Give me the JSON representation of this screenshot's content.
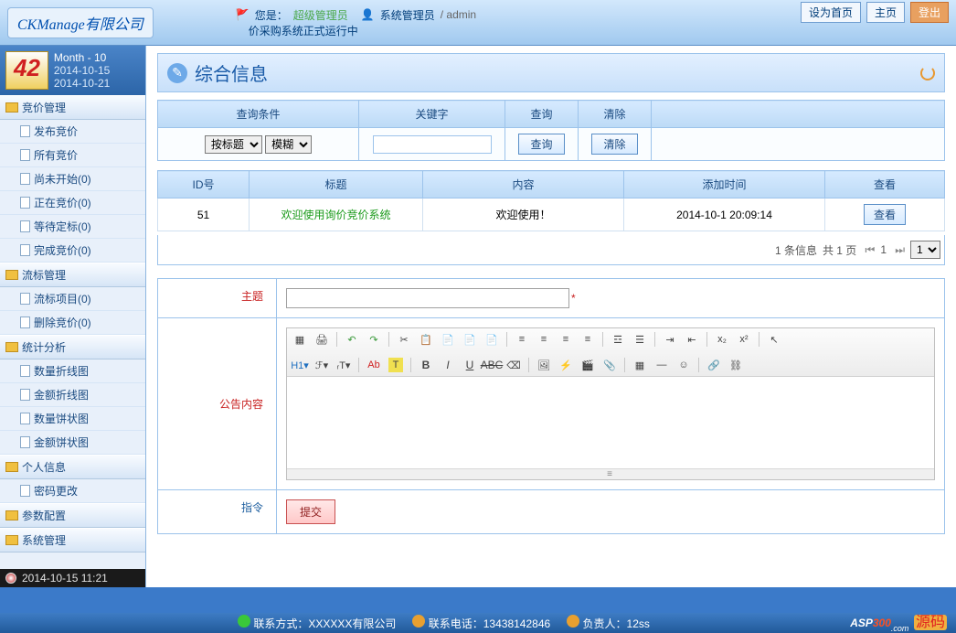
{
  "header": {
    "logo": "CKManage有限公司",
    "you_are": "您是：",
    "role": "超级管理员",
    "sys_admin": "系统管理员",
    "account": "/ admin",
    "running": "价采购系统正式运行中",
    "btn_home": "设为首页",
    "btn_main": "主页",
    "btn_logout": "登出"
  },
  "datebox": {
    "day": "42",
    "month": "Month - 10",
    "date1": "2014-10-15",
    "date2": "2014-10-21"
  },
  "nav": {
    "g_bid": "竞价管理",
    "publish": "发布竞价",
    "all": "所有竞价",
    "not_started": "尚未开始(0)",
    "inprogress": "正在竞价(0)",
    "pending": "等待定标(0)",
    "done": "完成竞价(0)",
    "g_fail": "流标管理",
    "fail_proj": "流标项目(0)",
    "del_bid": "删除竞价(0)",
    "g_stats": "统计分析",
    "qty_line": "数量折线图",
    "amt_line": "金额折线图",
    "qty_pie": "数量饼状图",
    "amt_pie": "金额饼状图",
    "g_personal": "个人信息",
    "pwd": "密码更改",
    "g_config": "参数配置",
    "g_sys": "系统管理"
  },
  "statusbar": {
    "time": "2014-10-15 11:21"
  },
  "page": {
    "title": "综合信息",
    "qcols": {
      "cond": "查询条件",
      "kw": "关键字",
      "query": "查询",
      "clear": "清除"
    },
    "qvals": {
      "sel1": "按标题",
      "sel2": "模糊",
      "btn_query": "查询",
      "btn_clear": "清除"
    },
    "dcols": {
      "id": "ID号",
      "title": "标题",
      "content": "内容",
      "time": "添加时间",
      "view": "查看"
    },
    "row": {
      "id": "51",
      "title": "欢迎使用询价竞价系统",
      "content": "欢迎使用！",
      "time": "2014-10-1 20:09:14",
      "view": "查看"
    },
    "pager": {
      "info": "1 条信息",
      "page": "共 1 页",
      "cur": "1",
      "sel": "1"
    },
    "form": {
      "subject": "主题",
      "body": "公告内容",
      "cmd": "指令",
      "submit": "提交",
      "star": "*"
    }
  },
  "footer": {
    "contact_label": "联系方式：",
    "contact": "XXXXXX有限公司",
    "tel_label": "联系电话：",
    "tel": "13438142846",
    "person_label": "负责人：",
    "person": "12ss"
  }
}
